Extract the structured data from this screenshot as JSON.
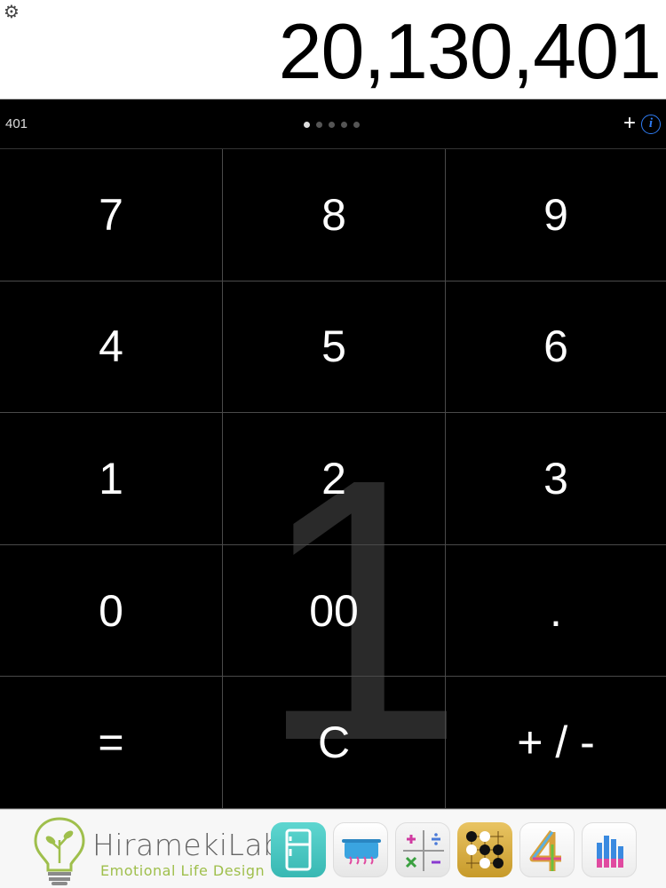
{
  "display": {
    "value": "20,130,401",
    "settings_icon": "gear-icon"
  },
  "status": {
    "memo": "401",
    "page_count": 5,
    "active_page": 1,
    "add_label": "+",
    "info_label": "i"
  },
  "keys": [
    "7",
    "8",
    "9",
    "4",
    "5",
    "6",
    "1",
    "2",
    "3",
    "0",
    "00",
    ".",
    "=",
    "C",
    "+ / -"
  ],
  "watermark": "1",
  "footer": {
    "brand": "HiramekiLab",
    "tagline": "Emotional Life Design",
    "apps": [
      {
        "icon": "refrigerator-app-icon"
      },
      {
        "icon": "cooking-pot-app-icon"
      },
      {
        "icon": "math-operators-app-icon"
      },
      {
        "icon": "go-board-app-icon"
      },
      {
        "icon": "number-four-app-icon"
      },
      {
        "icon": "bar-meter-app-icon"
      }
    ],
    "colors": {
      "brand_green": "#9fbf4c",
      "accent_blue": "#2f7df6"
    }
  }
}
